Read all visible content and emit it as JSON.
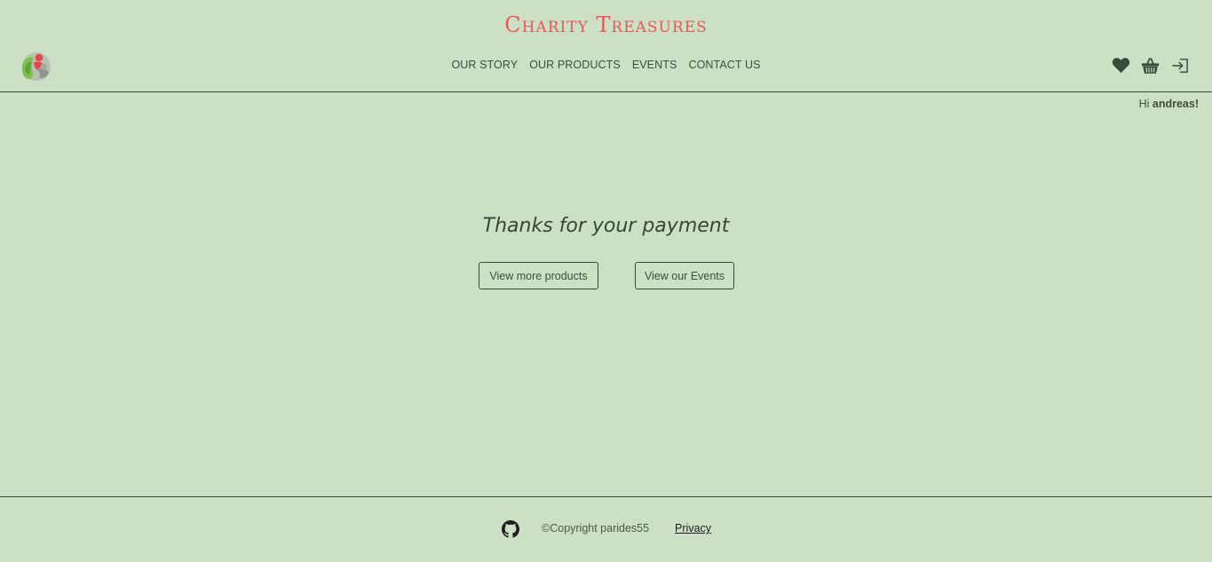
{
  "header": {
    "title": "Charity Treasures",
    "logo_icon": "charity-logo-icon",
    "nav": [
      {
        "label": "OUR STORY"
      },
      {
        "label": "OUR PRODUCTS"
      },
      {
        "label": "EVENTS"
      },
      {
        "label": "CONTACT US"
      }
    ],
    "icons": [
      "heart-icon",
      "basket-icon",
      "login-icon"
    ],
    "greeting_prefix": "Hi ",
    "username": "andreas!"
  },
  "main": {
    "message": "Thanks for your payment",
    "buttons": {
      "products_label": "View more products",
      "events_label": "View our Events"
    }
  },
  "footer": {
    "github_icon": "github-icon",
    "copyright": "©Copyright parides55",
    "privacy_label": "Privacy"
  },
  "colors": {
    "background": "#cce0c5",
    "title": "#e8575a",
    "text": "#3a4a3a"
  }
}
